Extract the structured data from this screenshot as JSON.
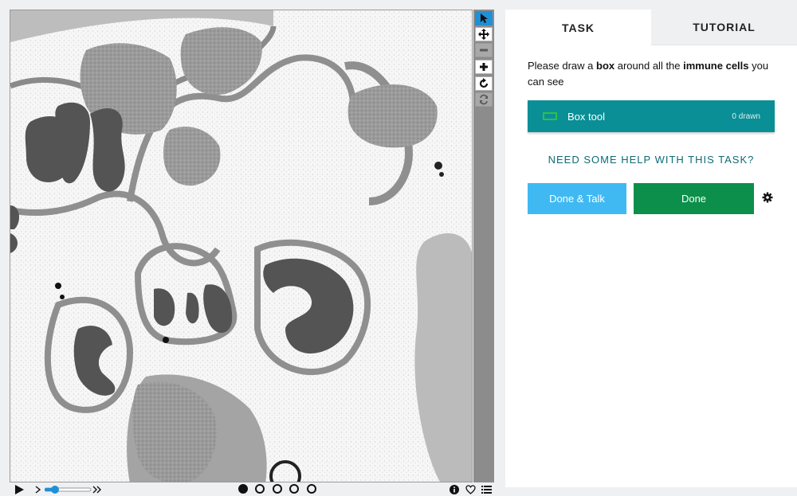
{
  "viewer": {
    "tools": [
      {
        "name": "select",
        "icon": "cursor-arrow-icon",
        "state": "active"
      },
      {
        "name": "pan",
        "icon": "move-arrows-icon",
        "state": "normal"
      },
      {
        "name": "zoom-out",
        "icon": "minus-icon",
        "state": "disabled"
      },
      {
        "name": "zoom-in",
        "icon": "plus-icon",
        "state": "normal"
      },
      {
        "name": "rotate",
        "icon": "rotate-icon",
        "state": "normal"
      },
      {
        "name": "reset",
        "icon": "refresh-icon",
        "state": "disabled"
      }
    ],
    "image_subject": "electron-micrograph-tissue"
  },
  "controls": {
    "play_icon": "play-icon",
    "frame_count": 5,
    "current_frame": 1,
    "right_icons": [
      "info-icon",
      "heart-icon",
      "list-icon"
    ]
  },
  "panel": {
    "tabs": [
      {
        "label": "TASK",
        "active": true
      },
      {
        "label": "TUTORIAL",
        "active": false
      }
    ],
    "instruction": {
      "part1": "Please draw a ",
      "bold1": "box",
      "part2": " around all the ",
      "bold2": "immune cells",
      "part3": " you can see"
    },
    "tool": {
      "label": "Box tool",
      "count": "0 drawn"
    },
    "help_text": "NEED SOME HELP WITH THIS TASK?",
    "done_talk_label": "Done & Talk",
    "done_label": "Done"
  },
  "colors": {
    "teal": "#0a8f96",
    "done_green": "#0c8f4a",
    "talk_blue": "#40b9f2",
    "active_tool": "#1f90d6",
    "tool_outline": "#2ec04b"
  }
}
